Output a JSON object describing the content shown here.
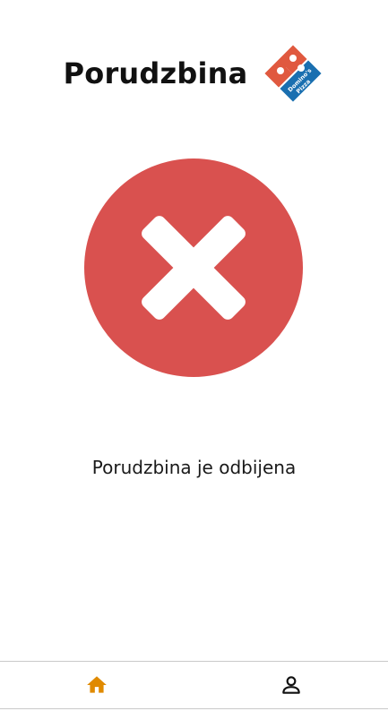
{
  "header": {
    "title": "Porudzbina",
    "logo_text": "Domino's Pizza"
  },
  "status": {
    "icon": "close-icon",
    "message": "Porudzbina je odbijena",
    "color": "#d9514f"
  },
  "nav": {
    "items": [
      {
        "icon": "home-icon",
        "active": true,
        "color": "#e08a00"
      },
      {
        "icon": "profile-icon",
        "active": false,
        "color": "#111111"
      }
    ]
  },
  "colors": {
    "brand_blue": "#1a6fb0",
    "brand_red": "#e04b3a"
  }
}
